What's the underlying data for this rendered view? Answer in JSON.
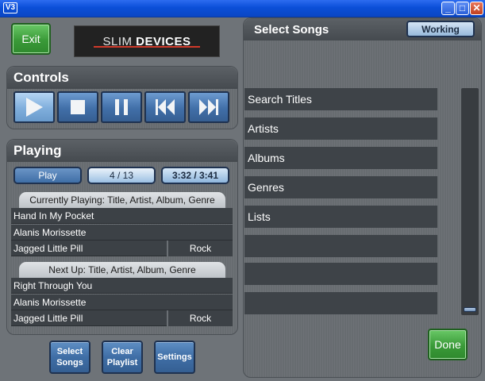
{
  "window": {
    "title": "V3",
    "minimize": "_",
    "maximize": "□",
    "close": "✕"
  },
  "top": {
    "exit_label": "Exit",
    "logo_part1": "SLIM",
    "logo_part2": "DEVICES"
  },
  "controls": {
    "title": "Controls",
    "icons": [
      "play-icon",
      "stop-icon",
      "pause-icon",
      "previous-icon",
      "next-icon"
    ]
  },
  "playing": {
    "title": "Playing",
    "mode": "Play",
    "track_position": "4 / 13",
    "time": "3:32 / 3:41",
    "current_header": "Currently Playing: Title, Artist, Album, Genre",
    "current": {
      "title": "Hand In My Pocket",
      "artist": "Alanis Morissette",
      "album": "Jagged Little Pill",
      "genre": "Rock"
    },
    "next_header": "Next Up: Title, Artist, Album, Genre",
    "next": {
      "title": "Right Through You",
      "artist": "Alanis Morissette",
      "album": "Jagged Little Pill",
      "genre": "Rock"
    }
  },
  "bottom_buttons": {
    "select_songs_line1": "Select",
    "select_songs_line2": "Songs",
    "clear_playlist_line1": "Clear",
    "clear_playlist_line2": "Playlist",
    "settings": "Settings"
  },
  "select_songs": {
    "title": "Select Songs",
    "status": "Working",
    "items": [
      "Search Titles",
      "Artists",
      "Albums",
      "Genres",
      "Lists",
      "",
      "",
      ""
    ],
    "done_label": "Done"
  },
  "colors": {
    "accent_green": "#3a9a38",
    "accent_blue": "#3f6ea6",
    "logo_red": "#d03a2a"
  }
}
